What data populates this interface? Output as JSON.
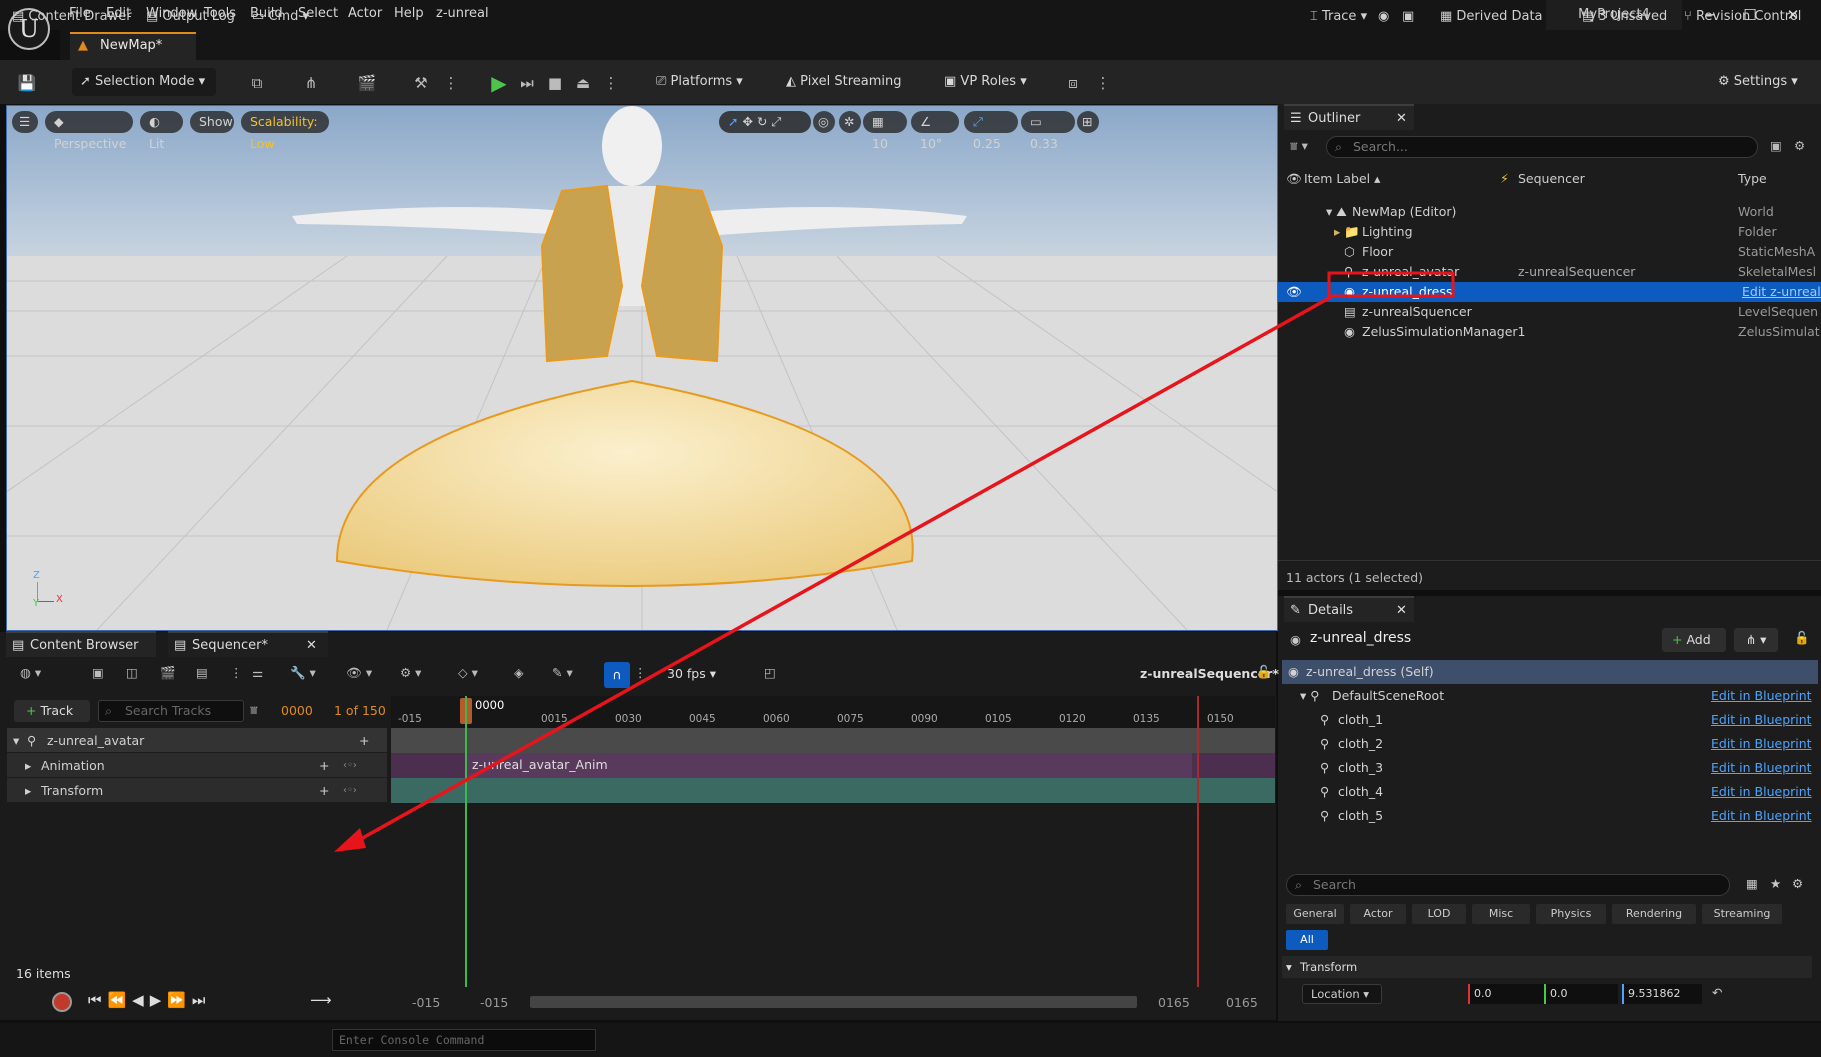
{
  "app": {
    "menus": [
      "File",
      "Edit",
      "Window",
      "Tools",
      "Build",
      "Select",
      "Actor",
      "Help",
      "z-unreal"
    ],
    "project": "MyProject4",
    "map_tab": "NewMap*"
  },
  "toolbar": {
    "mode": "Selection Mode",
    "platforms": "Platforms",
    "pixel_streaming": "Pixel Streaming",
    "vp_roles": "VP Roles",
    "settings": "Settings"
  },
  "viewport": {
    "perspective": "Perspective",
    "lit": "Lit",
    "show": "Show",
    "scalability": "Scalability: Low",
    "grid": "10",
    "angle": "10°",
    "scale": "0.25",
    "camera": "0.33",
    "axis_z": "Z",
    "axis_x": "X",
    "axis_y": "Y"
  },
  "outliner": {
    "tab": "Outliner",
    "search_placeholder": "Search...",
    "col_label": "Item Label",
    "col_seq": "Sequencer",
    "col_type": "Type",
    "rows": [
      {
        "label": "NewMap (Editor)",
        "seq": "",
        "type": "World"
      },
      {
        "label": "Lighting",
        "seq": "",
        "type": "Folder"
      },
      {
        "label": "Floor",
        "seq": "",
        "type": "StaticMeshA"
      },
      {
        "label": "z-unreal_avatar",
        "seq": "z-unrealSequencer",
        "type": "SkeletalMesl"
      },
      {
        "label": "z-unreal_dress",
        "seq": "",
        "type": "Edit z-unreal"
      },
      {
        "label": "z-unrealSquencer",
        "seq": "",
        "type": "LevelSequen"
      },
      {
        "label": "ZelusSimulationManager1",
        "seq": "",
        "type": "ZelusSimulat"
      }
    ],
    "footer": "11 actors (1 selected)"
  },
  "details": {
    "tab": "Details",
    "title": "z-unreal_dress",
    "add": "Add",
    "self": "z-unreal_dress (Self)",
    "root": "DefaultSceneRoot",
    "edit_link": "Edit in Blueprint",
    "components": [
      "cloth_1",
      "cloth_2",
      "cloth_3",
      "cloth_4",
      "cloth_5"
    ],
    "search_placeholder": "Search",
    "categories": [
      "General",
      "Actor",
      "LOD",
      "Misc",
      "Physics",
      "Rendering",
      "Streaming"
    ],
    "all": "All",
    "transform": "Transform",
    "location": "Location",
    "loc_x": "0.0",
    "loc_y": "0.0",
    "loc_z": "9.531862"
  },
  "sequencer": {
    "tab_content": "Content Browser",
    "tab_seq": "Sequencer*",
    "fps": "30 fps",
    "seq_name": "z-unrealSequencer*",
    "add_track": "Track",
    "search_tracks": "Search Tracks",
    "frame": "0000",
    "frame_of": "1 of 150",
    "playhead": "0000",
    "ticks": [
      "-015",
      "0015",
      "0030",
      "0045",
      "0060",
      "0075",
      "0090",
      "0105",
      "0120",
      "0135",
      "0150"
    ],
    "tracks": [
      "z-unreal_avatar",
      "Animation",
      "Transform"
    ],
    "anim_clip": "z-unreal_avatar_Anim",
    "items": "16 items",
    "range_start": "-015",
    "range_start2": "-015",
    "range_end": "0165",
    "range_end2": "0165"
  },
  "status": {
    "content_drawer": "Content Drawer",
    "output_log": "Output Log",
    "cmd": "Cmd",
    "console_placeholder": "Enter Console Command",
    "trace": "Trace",
    "derived": "Derived Data",
    "unsaved": "3 Unsaved",
    "revision": "Revision Control"
  },
  "colors": {
    "selection": "#0e5bbf",
    "annotation": "#e8141b",
    "accent": "#e08a1e"
  }
}
